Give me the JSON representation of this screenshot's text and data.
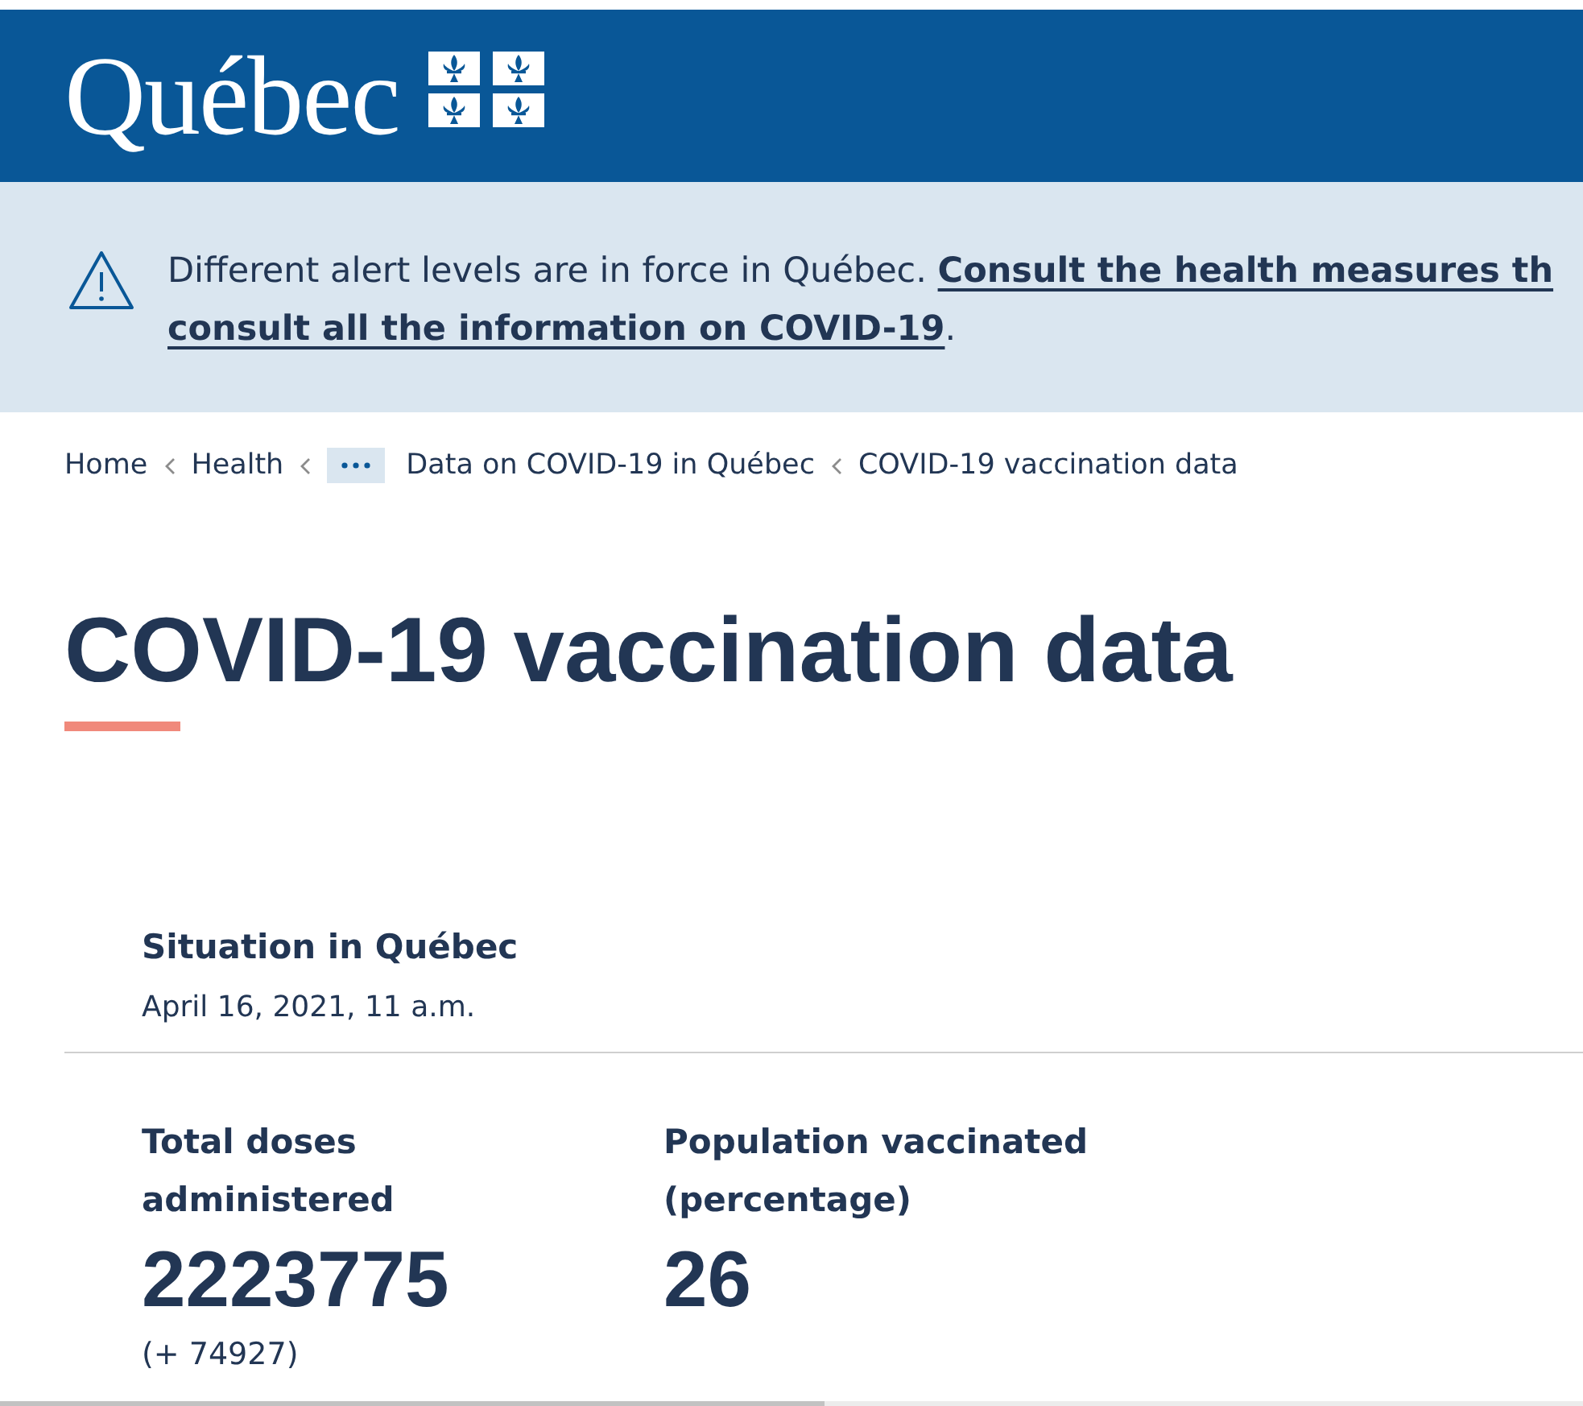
{
  "header": {
    "logo_text": "Québec"
  },
  "alert": {
    "lines": [
      [
        {
          "kind": "text",
          "text": "Different alert levels are in force in Québec."
        },
        {
          "kind": "link",
          "text": "Consult the health measures th"
        }
      ],
      [
        {
          "kind": "link",
          "text": "consult all the information on COVID-19"
        },
        {
          "kind": "text",
          "text": "."
        }
      ]
    ]
  },
  "breadcrumb": [
    {
      "kind": "link",
      "text": "Home"
    },
    {
      "kind": "link",
      "text": "Health"
    },
    {
      "kind": "more"
    },
    {
      "kind": "link",
      "text": "Data on COVID-19 in Québec"
    },
    {
      "kind": "current",
      "text": "COVID-19 vaccination data"
    }
  ],
  "page_title": "COVID-19 vaccination data",
  "situation": {
    "title": "Situation in Québec",
    "date": "April 16, 2021, 11 a.m."
  },
  "stats": [
    {
      "label": "Total doses administered",
      "value": "2223775",
      "change": "(+ 74927)"
    },
    {
      "label": "Population vaccinated (percentage)",
      "value": "26"
    }
  ]
}
